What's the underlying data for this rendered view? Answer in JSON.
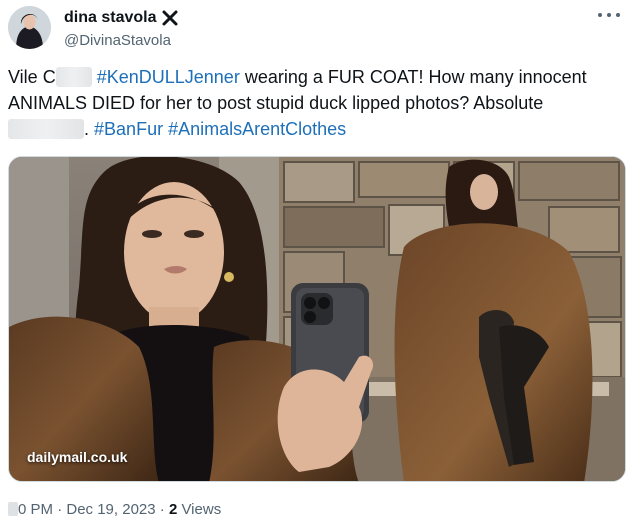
{
  "author": {
    "display_name": "dina stavola",
    "handle": "@DivinaStavola",
    "badge_icon": "x-cross-icon"
  },
  "more_icon": "more-options-icon",
  "text": {
    "line1_a": "Vile C",
    "line1_hashtag": "#KenDULLJenner",
    "line1_b": " wearing a FUR COAT! How many innocent",
    "line2": "ANIMALS DIED for her to post stupid duck lipped photos? Absolute",
    "line3_dot": ".",
    "hashtag_banfur": "#BanFur",
    "hashtag_animals": "#AnimalsArentClothes"
  },
  "media": {
    "watermark": "dailymail.co.uk"
  },
  "meta": {
    "time": "0 PM",
    "separator": "·",
    "date": "Dec 19, 2023",
    "views_count": "2",
    "views_label": "Views"
  },
  "colors": {
    "hashtag": "#1d6fb8",
    "secondary_text": "#536471",
    "primary_text": "#0f1419"
  }
}
